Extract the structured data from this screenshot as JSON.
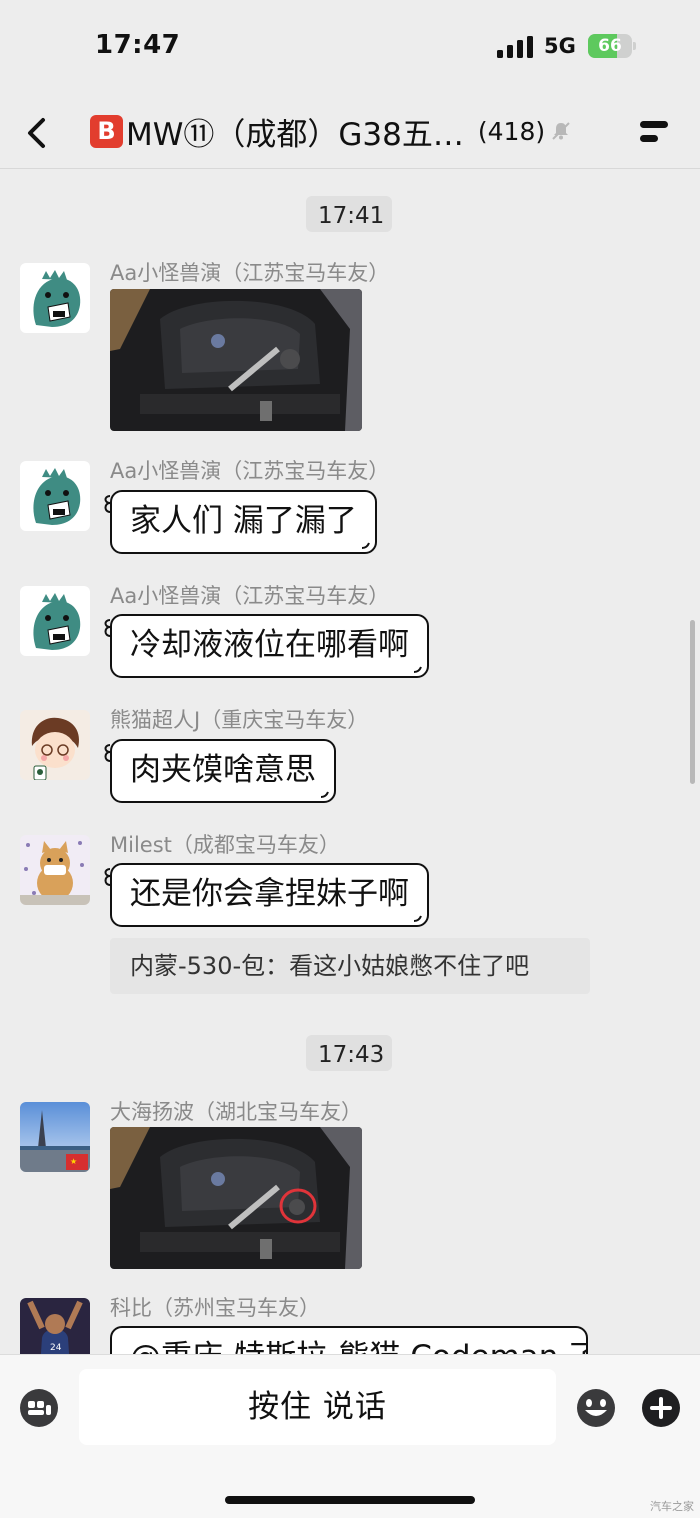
{
  "status_bar": {
    "time": "17:47",
    "network": "5G",
    "battery_level": "66",
    "battery_fraction": 0.66,
    "battery_color": "#5ec95e"
  },
  "header": {
    "badge_letter": "B",
    "title": "MW⑪（成都）G38五…",
    "member_count": "(418)",
    "icons": [
      "back-chevron-icon",
      "bell-muted-icon",
      "menu-lines-icon"
    ]
  },
  "chat": {
    "timestamps": [
      "17:41",
      "17:43"
    ],
    "messages": [
      {
        "sender": "Aa小怪兽演（江苏宝马车友）",
        "type": "image",
        "avatar": "green-dinosaur"
      },
      {
        "sender": "Aa小怪兽演（江苏宝马车友）",
        "type": "text",
        "text": "家人们 漏了漏了",
        "avatar": "green-dinosaur"
      },
      {
        "sender": "Aa小怪兽演（江苏宝马车友）",
        "type": "text",
        "text": "冷却液液位在哪看啊",
        "avatar": "green-dinosaur"
      },
      {
        "sender": "熊猫超人J（重庆宝马车友）",
        "type": "text",
        "text": "肉夹馍啥意思",
        "avatar": "cartoon-boy"
      },
      {
        "sender": "Milest（成都宝马车友）",
        "type": "text",
        "text": "还是你会拿捏妹子啊",
        "quote": "内蒙-530-包：看这小姑娘憋不住了吧",
        "avatar": "cartoon-cat"
      },
      {
        "sender": "大海扬波（湖北宝马车友）",
        "type": "image",
        "avatar": "paris-tower-photo"
      },
      {
        "sender": "科比（苏州宝马车友）",
        "type": "text",
        "text": "@重庆-特斯拉-熊猫 Codeman 了",
        "avatar": "basketball-player"
      }
    ]
  },
  "input_bar": {
    "hold_to_talk_label": "按住 说话",
    "icons": [
      "voice-toggle-icon",
      "emoji-icon",
      "plus-icon"
    ]
  },
  "watermark": "汽车之家"
}
